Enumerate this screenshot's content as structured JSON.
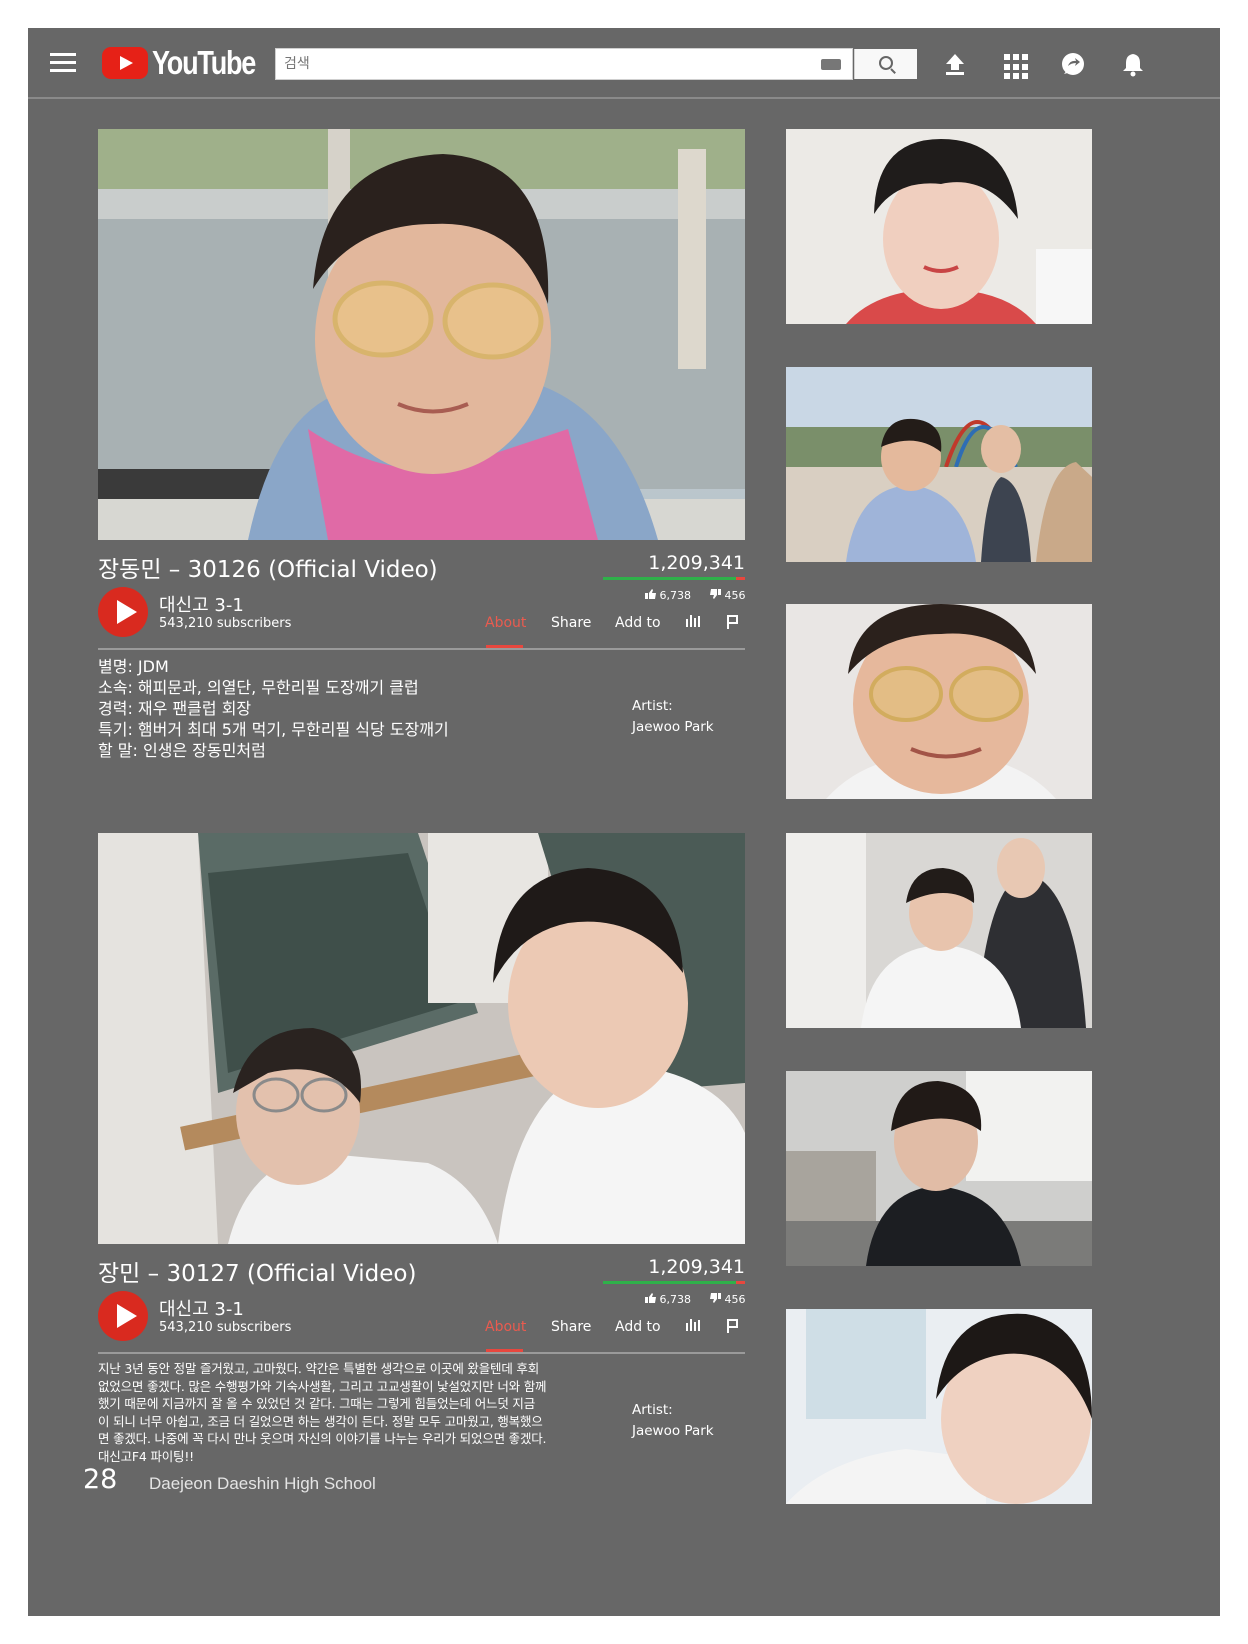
{
  "header": {
    "logo_text": "YouTube",
    "search_placeholder": "검색",
    "icons": [
      "menu-icon",
      "keyboard-icon",
      "search-icon",
      "upload-icon",
      "apps-icon",
      "messages-icon",
      "notifications-icon"
    ]
  },
  "videos": [
    {
      "title": "장동민 – 30126 (Official Video)",
      "views": "1,209,341",
      "likes": "6,738",
      "dislikes": "456",
      "like_ratio": 0.937,
      "channel": "대신고 3-1",
      "subscribers": "543,210 subscribers",
      "tabs": [
        "About",
        "Share",
        "Add to"
      ],
      "active_tab": "About",
      "description_lines": [
        "별명: JDM",
        "소속: 해피문과, 의열단, 무한리필 도장깨기 클럽",
        "경력: 재우 팬클럽 회장",
        "특기: 햄버거 최대 5개 먹기, 무한리필 식당 도장깨기",
        "할 말: 인생은 장동민처럼"
      ],
      "artist_label": "Artist:",
      "artist_name": "Jaewoo Park"
    },
    {
      "title": "장민 – 30127 (Official Video)",
      "views": "1,209,341",
      "likes": "6,738",
      "dislikes": "456",
      "like_ratio": 0.937,
      "channel": "대신고 3-1",
      "subscribers": "543,210 subscribers",
      "tabs": [
        "About",
        "Share",
        "Add to"
      ],
      "active_tab": "About",
      "description_lines": [
        "지난 3년 동안 정말 즐거웠고, 고마웠다. 약간은 특별한 생각으로 이곳에 왔을텐데 후회",
        "없었으면 좋겠다. 많은 수행평가와 기숙사생활, 그리고 고교생활이 낯설었지만 너와 함께",
        "했기 때문에 지금까지 잘 올 수 있었던 것 같다. 그때는 그렇게 힘들었는데 어느덧 지금",
        "이 되니 너무 아쉽고, 조금 더 길었으면 하는 생각이 든다. 정말 모두 고마웠고, 행복했으",
        "면 좋겠다. 나중에 꼭 다시 만나 웃으며 자신의 이야기를 나누는 우리가 되었으면 좋겠다.",
        "대신고F4 파이팅!!"
      ],
      "artist_label": "Artist:",
      "artist_name": "Jaewoo Park"
    }
  ],
  "footer": {
    "page_number": "28",
    "school": "Daejeon Daeshin High School"
  }
}
